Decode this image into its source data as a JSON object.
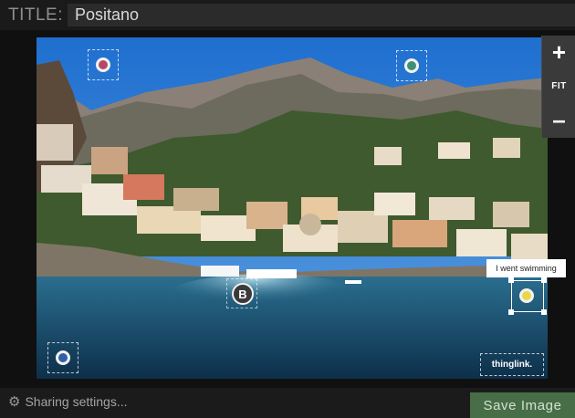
{
  "title_bar": {
    "label": "TITLE:",
    "value": "Positano"
  },
  "zoom": {
    "plus": "+",
    "fit": "FIT",
    "minus": "–"
  },
  "tags": [
    {
      "icon": "pin-icon",
      "color": "#b24a66"
    },
    {
      "icon": "pin-icon",
      "color": "#3e8f74"
    },
    {
      "icon": "pin-icon",
      "color": "#2f5fa6"
    },
    {
      "icon": "pin-icon",
      "color": "#e9d64a"
    }
  ],
  "tag_b": {
    "letter": "B"
  },
  "tooltip": {
    "text": "I went swimming"
  },
  "watermark": {
    "text": "thinglink."
  },
  "footer": {
    "share_label": "Sharing settings...",
    "save_label": "Save Image"
  },
  "colors": {
    "save_button": "#476e46",
    "background": "#161616",
    "input": "#2b2b2b"
  }
}
